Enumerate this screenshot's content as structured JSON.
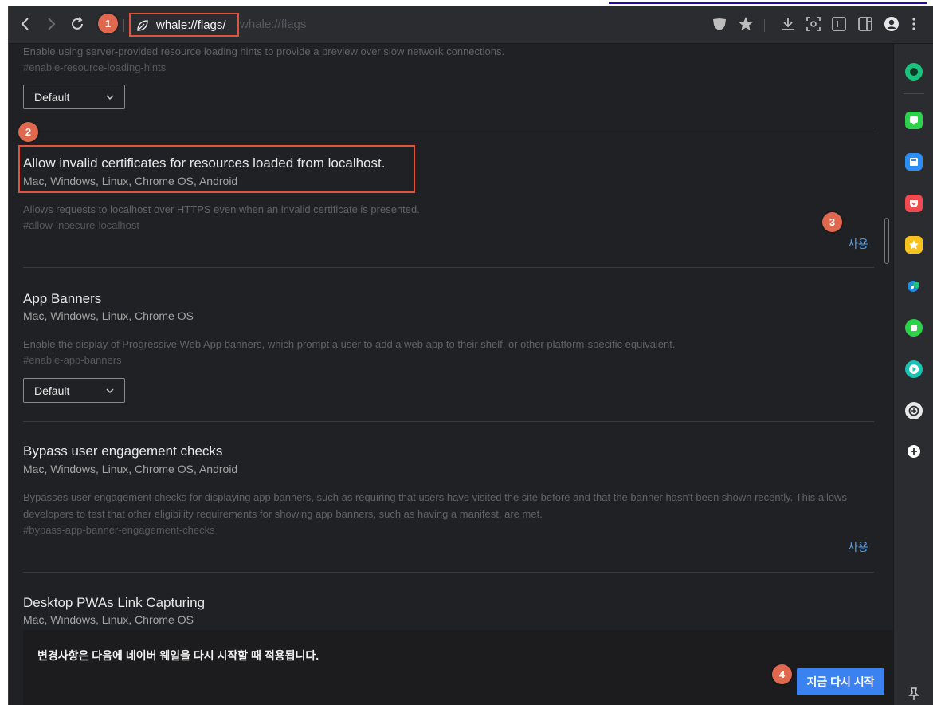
{
  "toolbar": {
    "back_icon": "chevron-left-icon",
    "forward_icon": "chevron-right-icon",
    "reload_icon": "reload-icon",
    "address_url": "whale://flags/",
    "ghost_url": "whale://flags",
    "right_icons": [
      "shield-icon",
      "star-icon",
      "download-icon",
      "capture-icon",
      "reader-icon",
      "sidebar-toggle-icon",
      "profile-icon",
      "menu-icon"
    ]
  },
  "badges": [
    "1",
    "2",
    "3",
    "4"
  ],
  "flags": [
    {
      "title": "",
      "platforms": "",
      "description": "Enable using server-provided resource loading hints to provide a preview over slow network connections.",
      "hash": "#enable-resource-loading-hints",
      "select_value": "Default"
    },
    {
      "title": "Allow invalid certificates for resources loaded from localhost.",
      "platforms": "Mac, Windows, Linux, Chrome OS, Android",
      "description": "Allows requests to localhost over HTTPS even when an invalid certificate is presented.",
      "hash": "#allow-insecure-localhost",
      "action": "사용"
    },
    {
      "title": "App Banners",
      "platforms": "Mac, Windows, Linux, Chrome OS",
      "description": "Enable the display of Progressive Web App banners, which prompt a user to add a web app to their shelf, or other platform-specific equivalent.",
      "hash": "#enable-app-banners",
      "select_value": "Default"
    },
    {
      "title": "Bypass user engagement checks",
      "platforms": "Mac, Windows, Linux, Chrome OS, Android",
      "description": "Bypasses user engagement checks for displaying app banners, such as requiring that users have visited the site before and that the banner hasn't been shown recently. This allows developers to test that other eligibility requirements for showing app banners, such as having a manifest, are met.",
      "hash": "#bypass-app-banner-engagement-checks",
      "action": "사용"
    },
    {
      "title": "Desktop PWAs Link Capturing",
      "platforms": "Mac, Windows, Linux, Chrome OS"
    }
  ],
  "notice": {
    "message": "변경사항은 다음에 네이버 웨일을 다시 시작할 때 적용됩니다.",
    "relaunch_label": "지금 다시 시작"
  },
  "sidebar": {
    "icons": [
      "naver-green-icon",
      "message-icon",
      "save-icon",
      "pocket-icon",
      "star-app-icon",
      "weather-icon",
      "line-icon",
      "play-icon",
      "openai-icon",
      "add-icon",
      "pin-icon"
    ],
    "colors": [
      "#19c37d",
      "#2bd24a",
      "#2b8ef5",
      "#f2494f",
      "#f7c21b",
      "#1e8fe0",
      "#2bd24a",
      "#19c3b4",
      "#e8e8e8",
      "#ffffff",
      "#cccccc"
    ]
  },
  "colors": {
    "background": "#202124",
    "toolbar": "#2b2c2f",
    "highlight": "#e0533c",
    "badge": "#e0684e",
    "link": "#5aa0e8",
    "button": "#3b82f0"
  }
}
